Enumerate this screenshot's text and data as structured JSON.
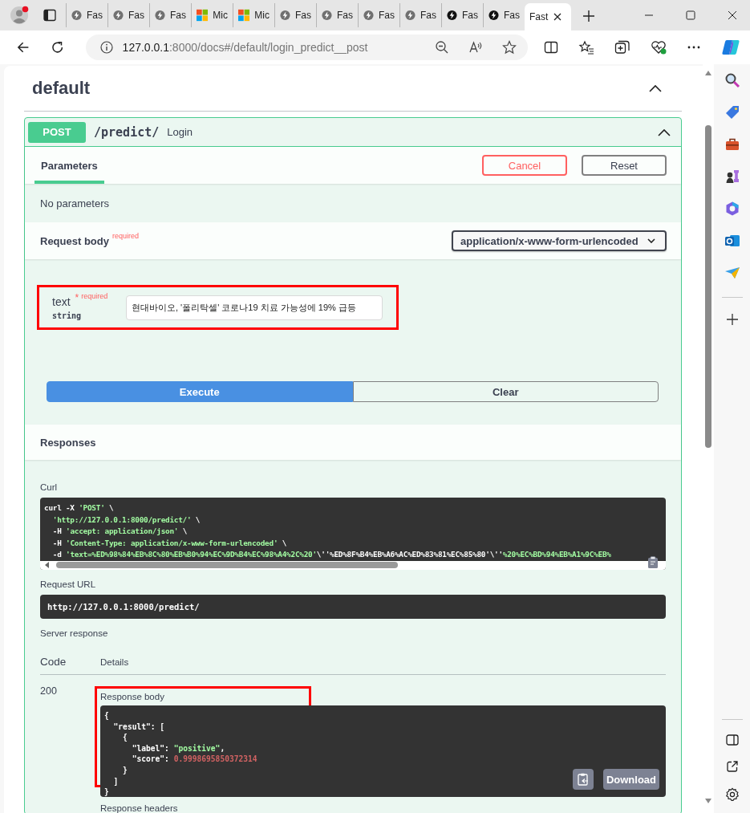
{
  "browser": {
    "tabs": [
      {
        "label": "Fas",
        "kind": "bolt",
        "selected": false
      },
      {
        "label": "Fas",
        "kind": "bolt",
        "selected": false
      },
      {
        "label": "Fas",
        "kind": "bolt",
        "selected": false
      },
      {
        "label": "Mic",
        "kind": "squares",
        "selected": false
      },
      {
        "label": "Mic",
        "kind": "squares",
        "selected": false
      },
      {
        "label": "Fas",
        "kind": "bolt",
        "selected": false
      },
      {
        "label": "Fas",
        "kind": "bolt",
        "selected": false
      },
      {
        "label": "Fas",
        "kind": "bolt",
        "selected": false
      },
      {
        "label": "Fas",
        "kind": "bolt",
        "selected": false
      },
      {
        "label": "Fas",
        "kind": "darkbolt",
        "selected": false
      },
      {
        "label": "Fas",
        "kind": "darkbolt",
        "selected": false
      },
      {
        "label": "Fast",
        "selected": true
      }
    ],
    "address": {
      "host": "127.0.0.1",
      "rest": ":8000/docs#/default/login_predict__post"
    }
  },
  "section": {
    "title": "default",
    "expanded": true
  },
  "operation": {
    "method": "POST",
    "path": "/predict/",
    "summary": "Login",
    "expanded": true,
    "tabs": [
      {
        "label": "Parameters",
        "selected": true
      }
    ],
    "cancel": "Cancel",
    "reset": "Reset",
    "no_params": "No parameters",
    "request_body": {
      "title": "Request body",
      "required": "required",
      "content_type": "application/x-www-form-urlencoded"
    },
    "fields": [
      {
        "name": "text",
        "required_mark": "*",
        "required": "required",
        "type": "string",
        "value": "현대바이오, '폴리탁셀' 코로나19 치료 가능성에 19% 급등"
      }
    ],
    "execute": "Execute",
    "clear": "Clear",
    "responses": {
      "title": "Responses",
      "curl_label": "Curl",
      "curl": [
        [
          {
            "text": "curl -X ",
            "kind": "plain"
          },
          {
            "text": "'POST'",
            "kind": "string"
          },
          {
            "text": " \\",
            "kind": "plain"
          }
        ],
        [
          {
            "text": "  'http://127.0.0.1:8000/predict/'",
            "kind": "string"
          },
          {
            "text": " \\",
            "kind": "plain"
          }
        ],
        [
          {
            "text": "  -H ",
            "kind": "plain"
          },
          {
            "text": "'accept: application/json'",
            "kind": "string"
          },
          {
            "text": " \\",
            "kind": "plain"
          }
        ],
        [
          {
            "text": "  -H ",
            "kind": "plain"
          },
          {
            "text": "'Content-Type: application/x-www-form-urlencoded'",
            "kind": "string"
          },
          {
            "text": " \\",
            "kind": "plain"
          }
        ],
        [
          {
            "text": "  -d ",
            "kind": "plain"
          },
          {
            "text": "'text=%ED%98%84%EB%8C%80%EB%B0%94%EC%9D%B4%EC%98%A4%2C%20'",
            "kind": "string"
          },
          {
            "text": "\\''%ED%8F%B4%EB%A6%AC%ED%83%81%EC%85%80'\\''",
            "kind": "plain"
          },
          {
            "text": "%20%EC%BD%94%EB%A1%9C%EB%",
            "kind": "string"
          }
        ]
      ],
      "request_url_label": "Request URL",
      "request_url": "http://127.0.0.1:8000/predict/",
      "server_response_label": "Server response",
      "columns": [
        "Code",
        "Details"
      ],
      "code": "200",
      "body_label": "Response body",
      "body": [
        [
          {
            "text": "{",
            "kind": "plain"
          }
        ],
        [
          {
            "text": "  \"result\": [",
            "kind": "plain"
          }
        ],
        [
          {
            "text": "    {",
            "kind": "plain"
          }
        ],
        [
          {
            "text": "      \"label\": ",
            "kind": "plain"
          },
          {
            "text": "\"positive\"",
            "kind": "string"
          },
          {
            "text": ",",
            "kind": "plain"
          }
        ],
        [
          {
            "text": "      \"score\": ",
            "kind": "plain"
          },
          {
            "text": "0.9998695850372314",
            "kind": "number"
          }
        ],
        [
          {
            "text": "    }",
            "kind": "plain"
          }
        ],
        [
          {
            "text": "  ]",
            "kind": "plain"
          }
        ],
        [
          {
            "text": "}",
            "kind": "plain"
          }
        ]
      ],
      "download": "Download",
      "headers_label": "Response headers"
    }
  }
}
